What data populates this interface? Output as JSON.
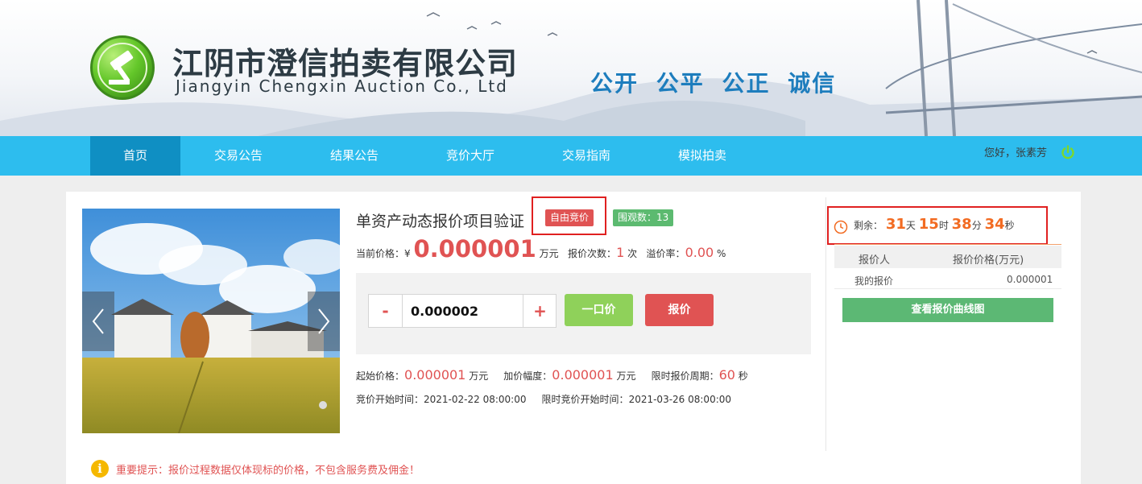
{
  "header": {
    "company_cn": "江阴市澄信拍卖有限公司",
    "company_en": "Jiangyin Chengxin Auction Co., Ltd",
    "slogan": "公开 公平 公正 诚信"
  },
  "nav": {
    "items": [
      "首页",
      "交易公告",
      "结果公告",
      "竞价大厅",
      "交易指南",
      "模拟拍卖"
    ],
    "active_index": 0,
    "greeting": "您好，张素芳"
  },
  "item": {
    "title": "单资产动态报价项目验证",
    "badge_mode": "自由竞价",
    "badge_views": "围观数：13"
  },
  "price_row": {
    "current_label": "当前价格：",
    "currency": "¥",
    "current_price": "0.000001",
    "unit": "万元",
    "bid_count_label": "报价次数：",
    "bid_count": "1",
    "bid_count_unit": "次",
    "premium_label": "溢价率：",
    "premium": "0.00",
    "premium_unit": "%"
  },
  "bid": {
    "minus": "-",
    "plus": "+",
    "amount": "0.000002",
    "buyout_label": "一口价",
    "bid_label": "报价"
  },
  "details": {
    "start_price_label": "起始价格：",
    "start_price": "0.000001",
    "increment_label": "加价幅度：",
    "increment": "0.000001",
    "unit": "万元",
    "period_label": "限时报价周期：",
    "period": "60",
    "period_unit": "秒",
    "start_time_label": "竞价开始时间：",
    "start_time": "2021-02-22 08:00:00",
    "limited_start_label": "限时竞价开始时间：",
    "limited_start": "2021-03-26 08:00:00"
  },
  "countdown": {
    "label": "剩余：",
    "days": "31",
    "days_unit": "天",
    "hours": "15",
    "hours_unit": "时",
    "minutes": "38",
    "minutes_unit": "分",
    "seconds": "34",
    "seconds_unit": "秒"
  },
  "bid_table": {
    "headers": [
      "报价人",
      "报价价格(万元)"
    ],
    "rows": [
      [
        "我的报价",
        "0.000001"
      ]
    ],
    "curve_button": "查看报价曲线图"
  },
  "notice": {
    "icon": "i",
    "text": "重要提示：报价过程数据仅体现标的价格，不包含服务费及佣金！"
  },
  "colors": {
    "nav": "#2dbdee",
    "nav_active": "#0f8fc3",
    "accent_red": "#e05353",
    "green": "#5cb874",
    "countdown": "#f26b22"
  }
}
